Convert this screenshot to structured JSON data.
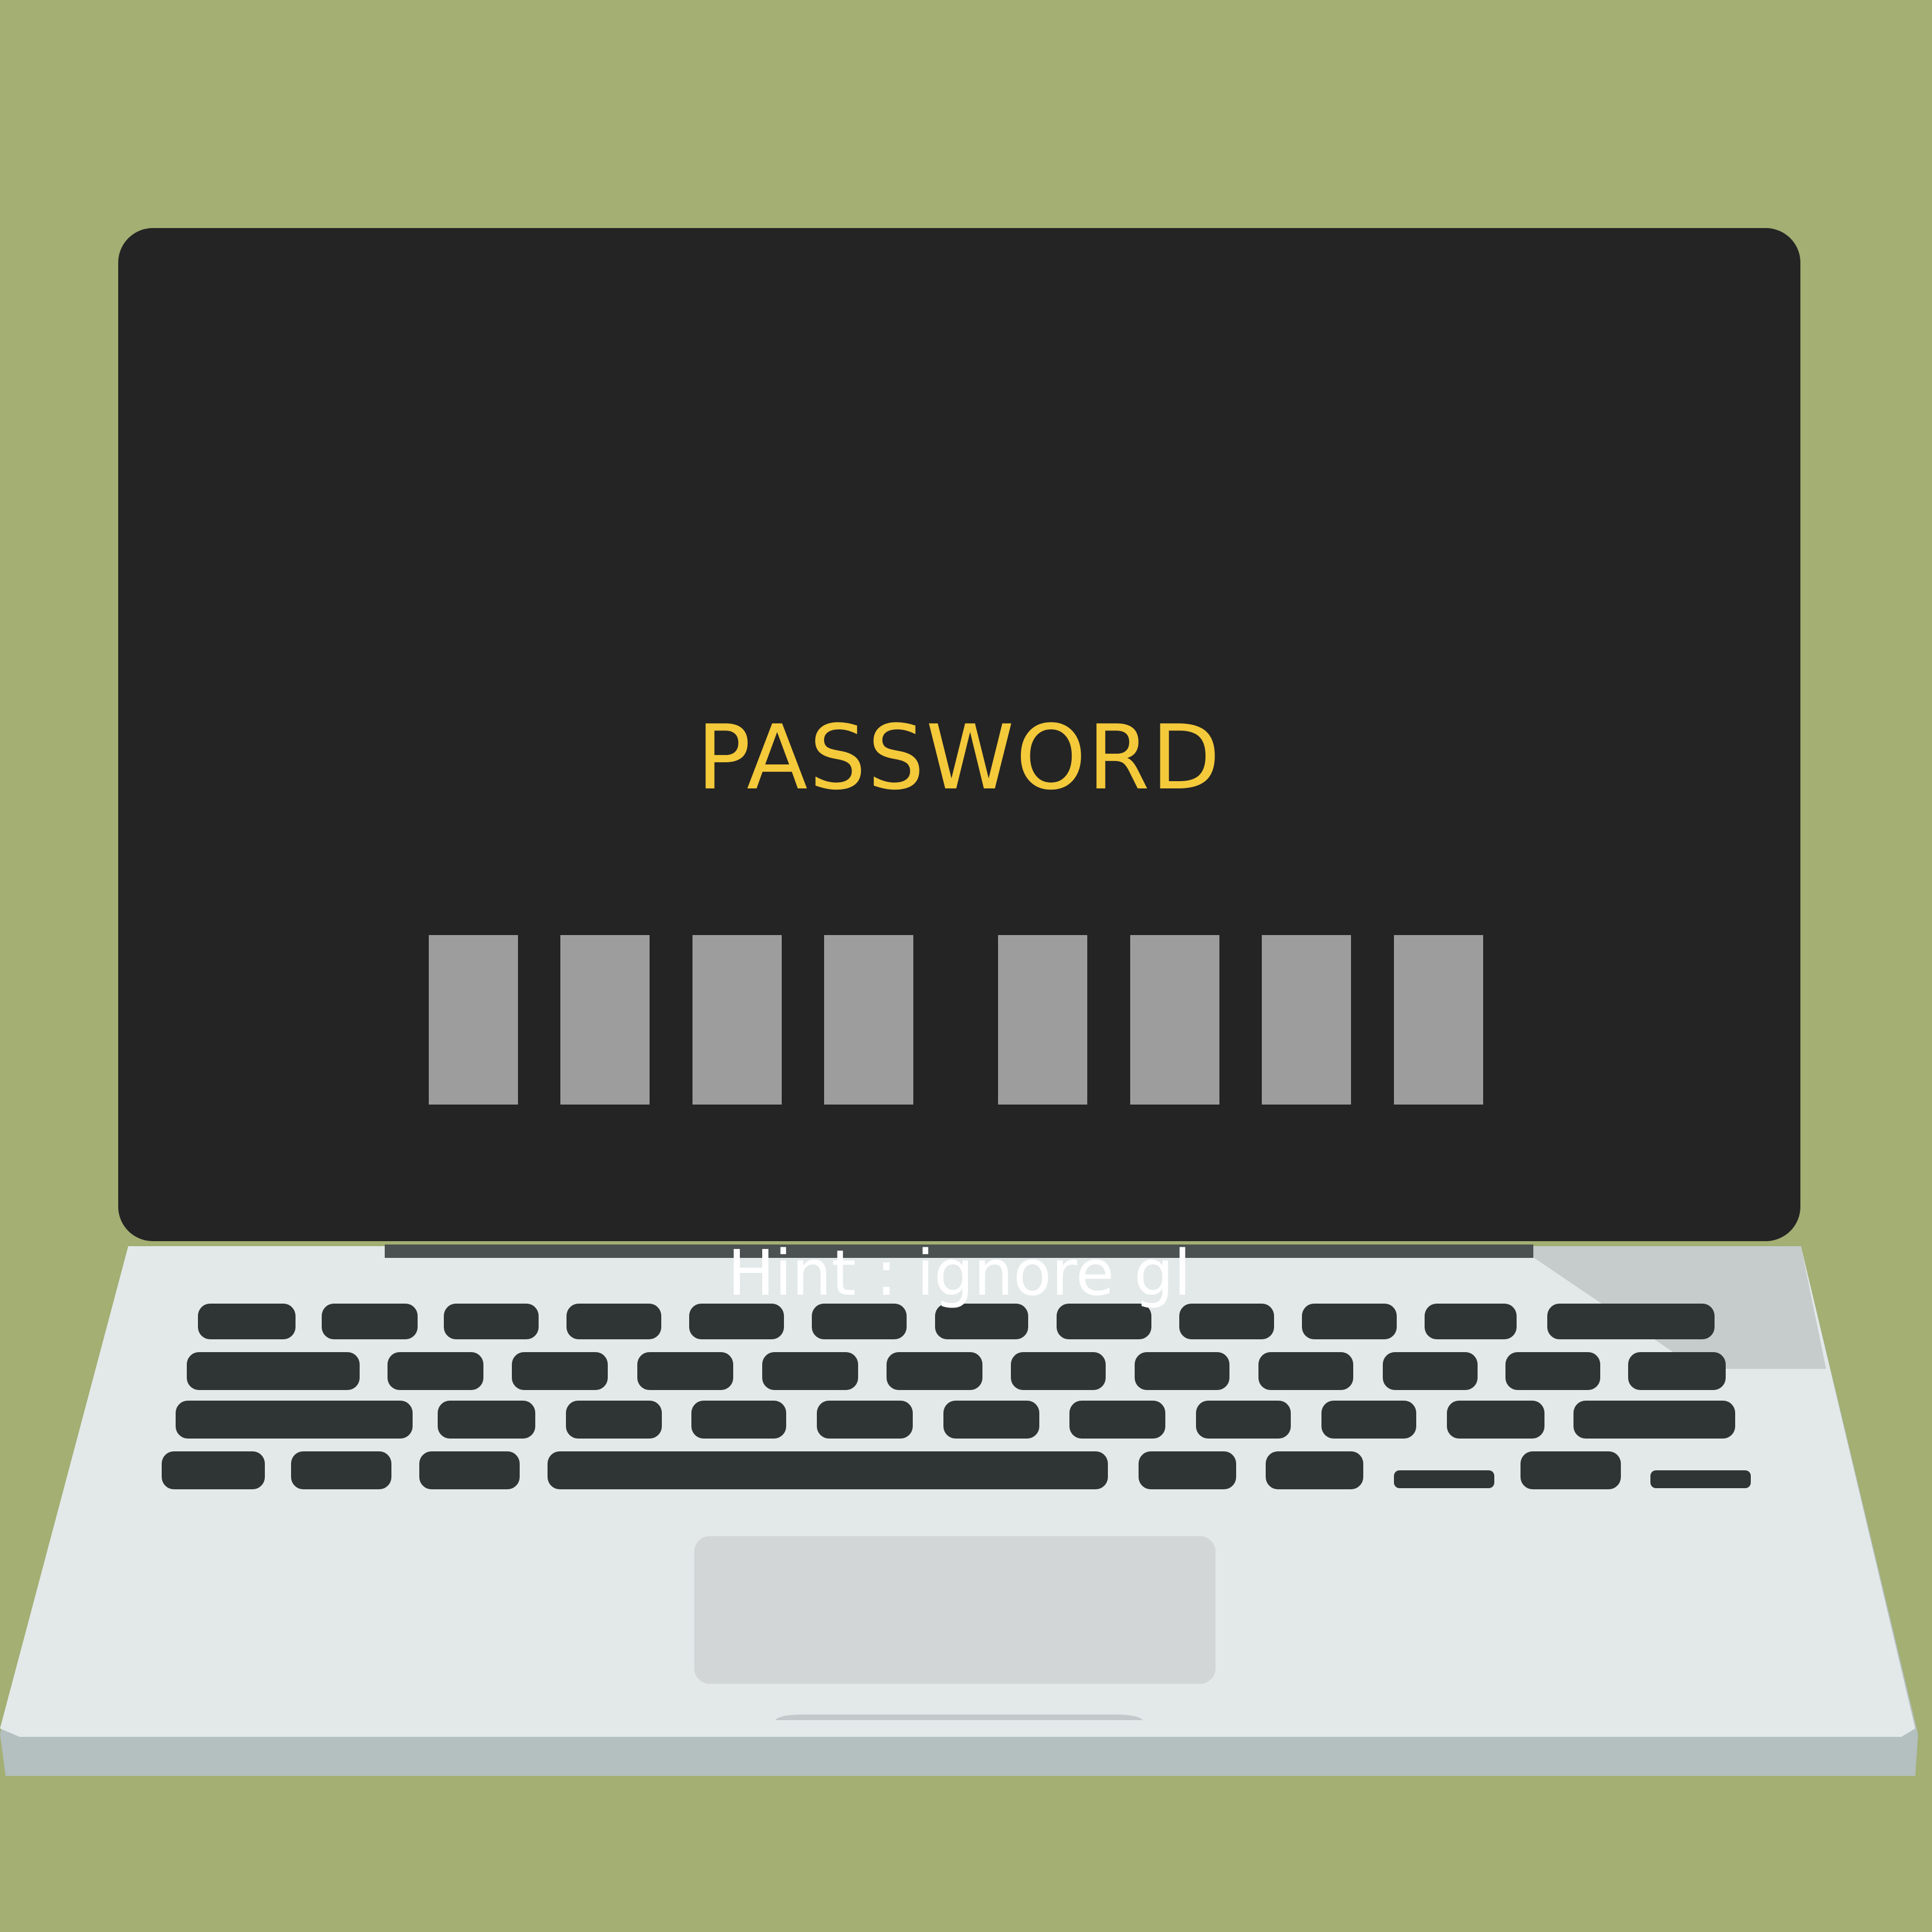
{
  "lock_screen": {
    "title": "PASSWORD",
    "password_slots": 8,
    "hint": "Hint : ignore gl"
  },
  "colors": {
    "background": "#a3af73",
    "screen": "#242424",
    "title": "#f4c93a",
    "slot": "#9d9d9d",
    "hint": "#ffffff",
    "keyboard_deck": "#e3e9e9",
    "keys": "#2e3534"
  }
}
